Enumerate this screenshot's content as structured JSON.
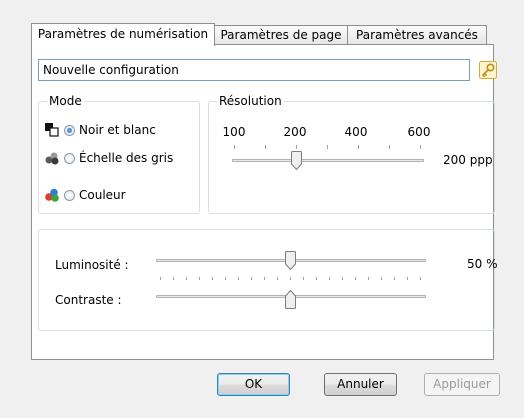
{
  "tabs": [
    {
      "label": "Paramètres de numérisation",
      "active": true
    },
    {
      "label": "Paramètres de page",
      "active": false
    },
    {
      "label": "Paramètres avancés",
      "active": false
    }
  ],
  "config": {
    "value": "Nouvelle configuration",
    "icon": "key-icon"
  },
  "mode": {
    "label": "Mode",
    "options": [
      {
        "label": "Noir et blanc",
        "checked": true,
        "icon": "black-white-icon"
      },
      {
        "label": "Échelle des gris",
        "checked": false,
        "icon": "grayscale-icon"
      },
      {
        "label": "Couleur",
        "checked": false,
        "icon": "color-icon"
      }
    ]
  },
  "resolution": {
    "label": "Résolution",
    "ticks": [
      "100",
      "200",
      "400",
      "600"
    ],
    "value": "200 ppp",
    "selected_dpi": 200
  },
  "brightness": {
    "label": "Luminosité :",
    "value_text": "50 %",
    "percent": 50
  },
  "contrast": {
    "label": "Contraste :",
    "percent": 50
  },
  "buttons": {
    "ok": "OK",
    "cancel": "Annuler",
    "apply": "Appliquer"
  },
  "colors": {
    "focus_border": "#3c7fb1",
    "panel_border": "#8e8f8f"
  }
}
